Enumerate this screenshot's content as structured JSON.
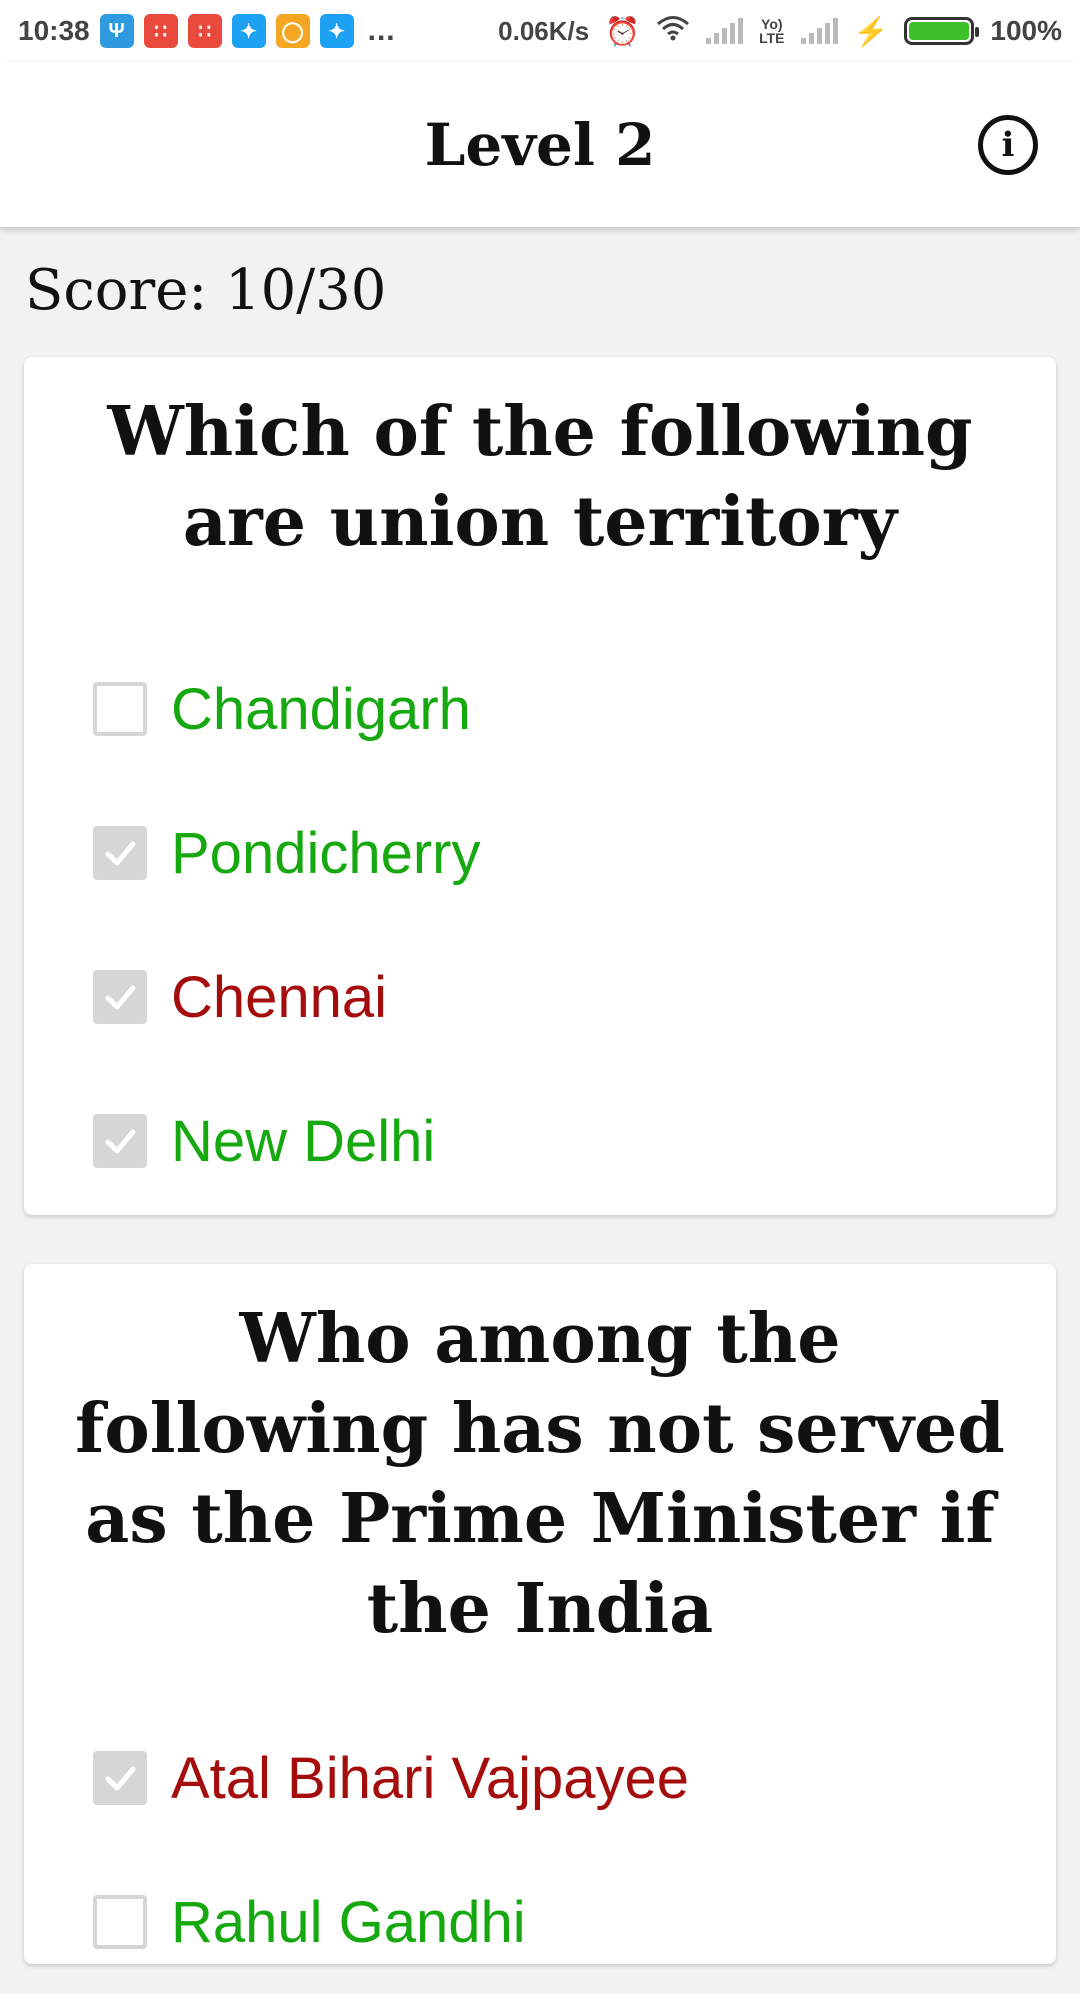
{
  "status_bar": {
    "time": "10:38",
    "net_speed": "0.06K/s",
    "battery": "100%",
    "lte_label_top": "Yo)",
    "lte_label_bottom": "LTE",
    "overflow": "..."
  },
  "header": {
    "title": "Level 2",
    "info_glyph": "i"
  },
  "score": "Score: 10/30",
  "colors": {
    "correct": "#16a80f",
    "wrong": "#a50d0d",
    "checkbox_gray": "#d6d6d6"
  },
  "questions": [
    {
      "text": "Which of the following are union territory",
      "options": [
        {
          "label": "Chandigarh",
          "checked": false,
          "status": "correct"
        },
        {
          "label": "Pondicherry",
          "checked": true,
          "status": "correct"
        },
        {
          "label": "Chennai",
          "checked": true,
          "status": "wrong"
        },
        {
          "label": "New Delhi",
          "checked": true,
          "status": "correct"
        }
      ]
    },
    {
      "text": "Who among the following has not served as the Prime Minister if the India",
      "options": [
        {
          "label": "Atal Bihari Vajpayee",
          "checked": true,
          "status": "wrong"
        },
        {
          "label": "Rahul Gandhi",
          "checked": false,
          "status": "correct"
        }
      ]
    }
  ]
}
